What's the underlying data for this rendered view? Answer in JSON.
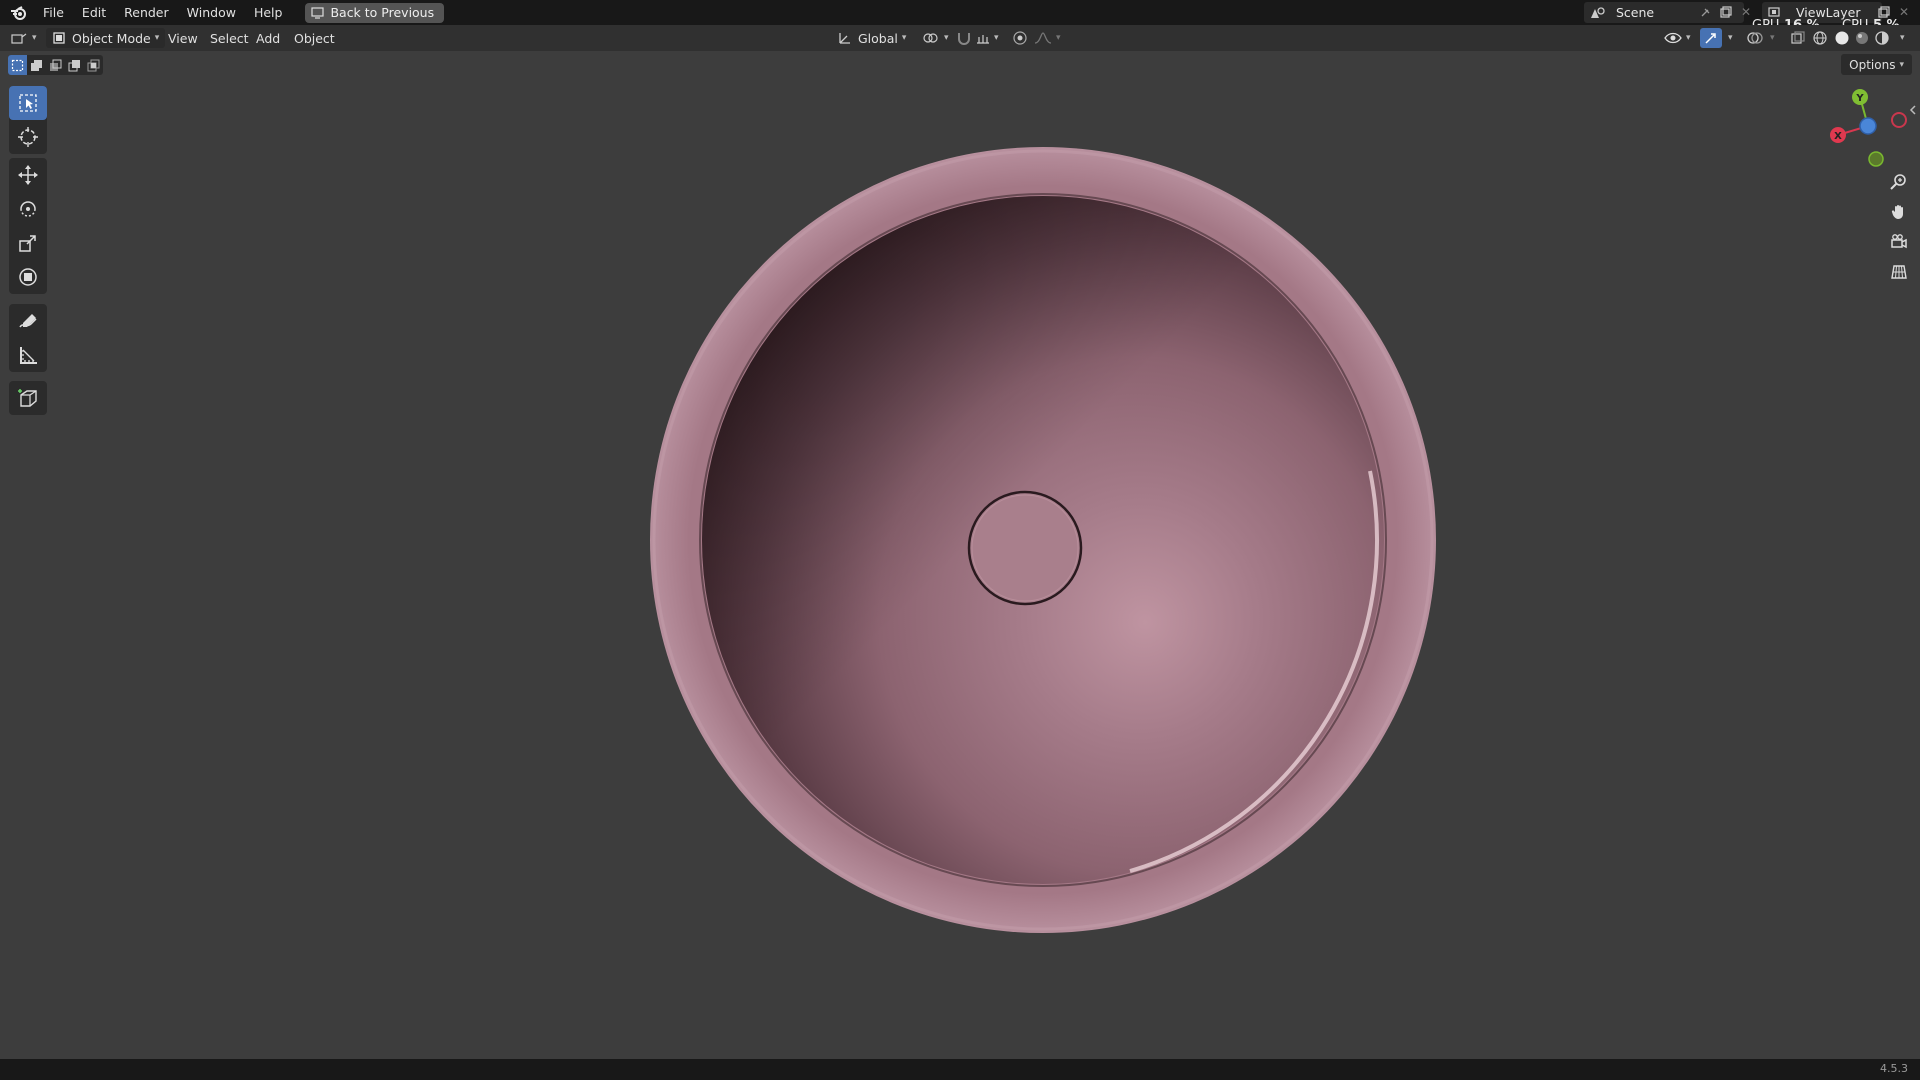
{
  "menu": {
    "items": [
      "File",
      "Edit",
      "Render",
      "Window",
      "Help"
    ],
    "back_button": "Back to Previous"
  },
  "scene": {
    "name": "Scene"
  },
  "view_layer": {
    "name": "ViewLayer"
  },
  "stats": {
    "gpu_label": "GPU",
    "gpu_value": "16 %",
    "cpu_label": "CPU",
    "cpu_value": "5 %"
  },
  "header": {
    "mode": "Object Mode",
    "menus": [
      "View",
      "Select",
      "Add",
      "Object"
    ],
    "transform_orientation": "Global"
  },
  "viewport": {
    "options_label": "Options",
    "gizmo": {
      "y_label": "Y",
      "x_label": "X"
    },
    "object_color": "#a57b89"
  },
  "status": {
    "version": "4.5.3"
  },
  "icons": {
    "tools": [
      "select-box-icon",
      "cursor-icon",
      "move-icon",
      "rotate-icon",
      "scale-icon",
      "transform-icon",
      "annotate-icon",
      "measure-icon",
      "add-cube-icon"
    ],
    "nav": [
      "zoom-icon",
      "pan-hand-icon",
      "camera-icon",
      "perspective-grid-icon"
    ]
  }
}
